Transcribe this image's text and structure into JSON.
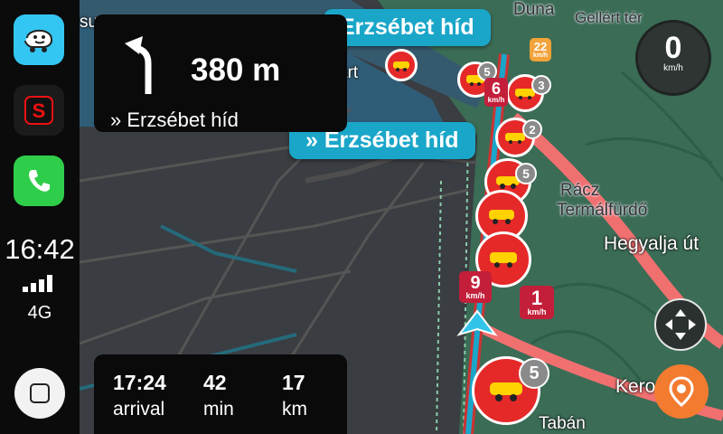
{
  "sidebar": {
    "time": "16:42",
    "network": "4G",
    "apps": [
      {
        "name": "waze-app-icon",
        "color": "#34c6f2"
      },
      {
        "name": "s-app-icon",
        "color": "#222"
      },
      {
        "name": "phone-app-icon",
        "color": "#2fce4a"
      }
    ]
  },
  "navigation": {
    "turn_distance": "380 m",
    "turn_street": "» Erzsébet híd",
    "next_sign": "» Erzsébet híd",
    "top_sign": "Erzsébet híd"
  },
  "trip": {
    "arrival_time": "17:24",
    "arrival_label": "arrival",
    "minutes": "42",
    "minutes_label": "min",
    "distance": "17",
    "distance_label": "km"
  },
  "speedometer": {
    "value": "0",
    "unit": "km/h"
  },
  "map_labels": {
    "duna": "Duna",
    "gellert": "Gellért tér",
    "racz1": "Rácz",
    "racz2": "Termálfürdő",
    "hegyalja": "Hegyalja út",
    "taban": "Tabán",
    "kero": "Kero",
    "art": "art",
    "su": "su"
  },
  "speed_pins": [
    {
      "value": "6",
      "unit": "km/h"
    },
    {
      "value": "9",
      "unit": "km/h"
    },
    {
      "value": "1",
      "unit": "km/h"
    },
    {
      "value": "22",
      "unit": "km/h"
    }
  ],
  "jam_counts": [
    "5",
    "3",
    "2",
    "5",
    "5"
  ],
  "colors": {
    "accent_blue": "#1aa6c9",
    "jam_red": "#e52929",
    "map_green": "#3a6e57",
    "report_orange": "#f27b30"
  }
}
